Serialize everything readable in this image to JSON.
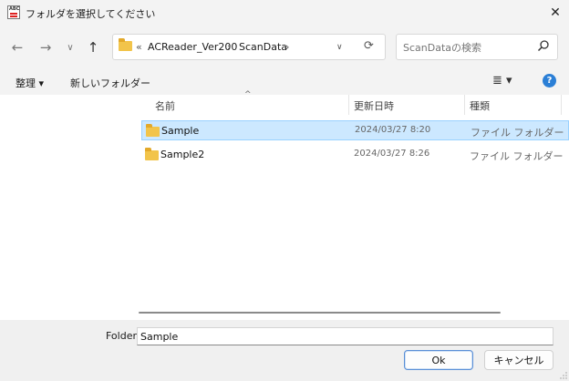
{
  "window": {
    "title": "フォルダを選択してください",
    "close_glyph": "✕"
  },
  "nav": {
    "back": "←",
    "forward": "→",
    "recent": "∨",
    "up": "↑"
  },
  "address": {
    "overflow": "«",
    "crumbs": [
      "ACReader_Ver200",
      "ScanData"
    ],
    "sep": "›",
    "dropdown": "∨",
    "refresh": "⟳"
  },
  "search": {
    "placeholder": "ScanDataの検索"
  },
  "toolbar": {
    "organize": "整理 ▾",
    "new_folder": "新しいフォルダー",
    "view": "≣ ▾",
    "help": "?"
  },
  "columns": {
    "name": "名前",
    "date": "更新日時",
    "type": "種類"
  },
  "files": [
    {
      "name": "Sample",
      "date": "2024/03/27 8:20",
      "type": "ファイル フォルダー",
      "selected": true
    },
    {
      "name": "Sample2",
      "date": "2024/03/27 8:26",
      "type": "ファイル フォルダー",
      "selected": false
    }
  ],
  "folder_field": {
    "label": "Folder",
    "value": "Sample"
  },
  "buttons": {
    "ok": "Ok",
    "cancel": "キャンセル"
  },
  "colors": {
    "selection": "#cce8ff",
    "folder": "#f2c44a",
    "help": "#2b7fd6"
  }
}
